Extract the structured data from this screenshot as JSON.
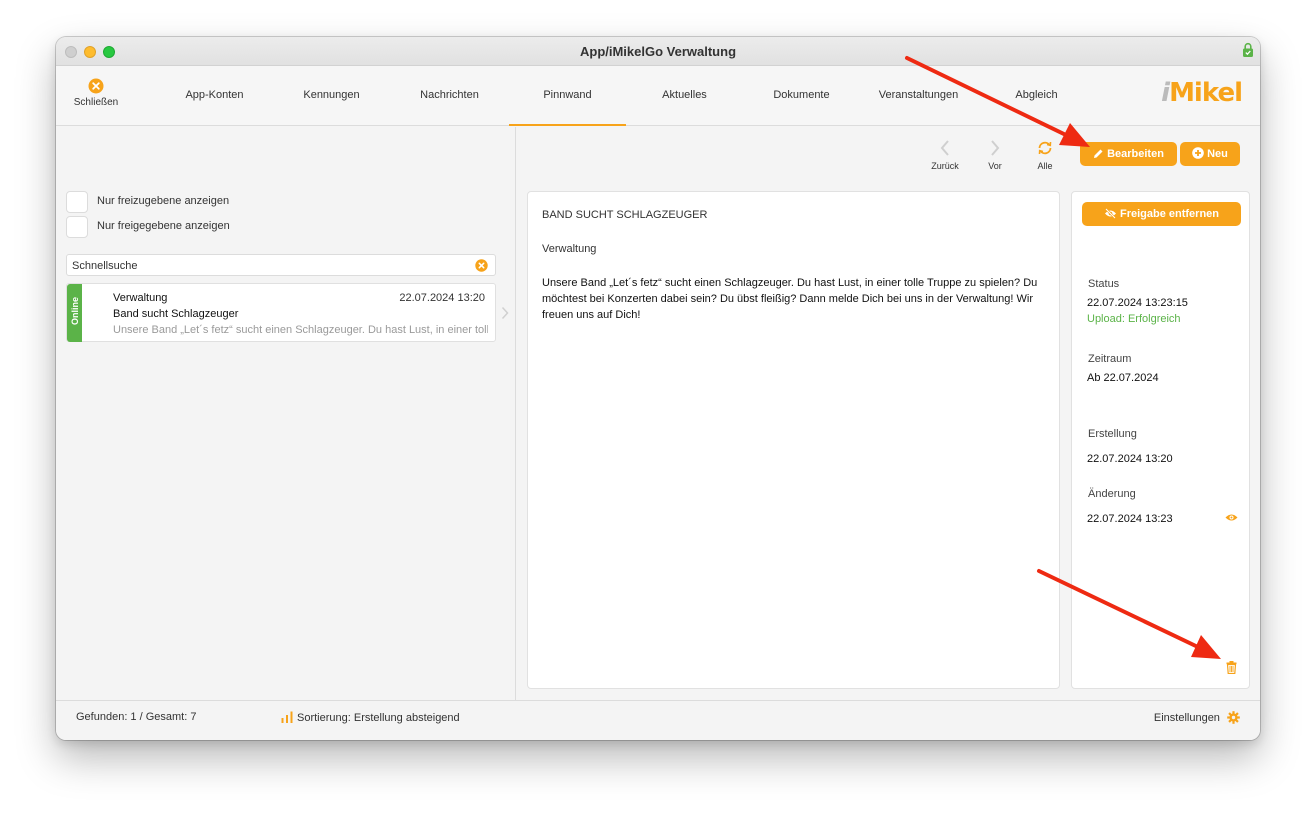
{
  "window": {
    "title": "App/iMikelGo Verwaltung"
  },
  "toolbar": {
    "close_label": "Schließen",
    "tabs": [
      "App-Konten",
      "Kennungen",
      "Nachrichten",
      "Pinnwand",
      "Aktuelles",
      "Dokumente",
      "Veranstaltungen",
      "Abgleich"
    ],
    "active_tab": "Pinnwand",
    "logo_text_i": "i",
    "logo_text_rest": "Mikel"
  },
  "filters": {
    "only_unreleased": "Nur freizugebene anzeigen",
    "only_released": "Nur freigegebene anzeigen"
  },
  "search": {
    "value": "Schnellsuche",
    "placeholder": "Schnellsuche"
  },
  "list": {
    "items": [
      {
        "status": "Online",
        "author": "Verwaltung",
        "date": "22.07.2024 13:20",
        "title": "Band sucht Schlagzeuger",
        "preview": "Unsere Band „Let´s fetz“ sucht einen Schlagzeuger. Du hast Lust, in einer tolle Truppe zu spielen?"
      }
    ]
  },
  "actions": {
    "back": "Zurück",
    "forward": "Vor",
    "all": "Alle",
    "edit": "Bearbeiten",
    "new": "Neu"
  },
  "post": {
    "title": "BAND SUCHT SCHLAGZEUGER",
    "author": "Verwaltung",
    "body": "Unsere Band „Let´s fetz“ sucht einen Schlagzeuger. Du hast Lust, in einer tolle Truppe zu spielen? Du möchtest bei Konzerten dabei sein? Du übst fleißig? Dann melde Dich bei uns in der Verwaltung! Wir freuen uns auf Dich!"
  },
  "details": {
    "release_button": "Freigabe entfernen",
    "status_label": "Status",
    "status_date": "22.07.2024 13:23:15",
    "status_upload": "Upload: Erfolgreich",
    "period_label": "Zeitraum",
    "period_value": "Ab 22.07.2024",
    "created_label": "Erstellung",
    "created_value": "22.07.2024 13:20",
    "changed_label": "Änderung",
    "changed_value": "22.07.2024 13:23"
  },
  "statusbar": {
    "found": "Gefunden: 1 / Gesamt: 7",
    "sort": "Sortierung: Erstellung absteigend",
    "settings": "Einstellungen"
  },
  "colors": {
    "accent": "#f7a31a",
    "online": "#5bb348",
    "annotation_arrow": "#ee2a12"
  },
  "icons": [
    "close-circle-icon",
    "lock-icon",
    "chevron-left-icon",
    "chevron-right-icon",
    "refresh-icon",
    "pencil-icon",
    "plus-circle-icon",
    "eye-slash-icon",
    "eye-icon",
    "trash-icon",
    "bar-chart-icon",
    "gear-icon",
    "clear-icon"
  ]
}
